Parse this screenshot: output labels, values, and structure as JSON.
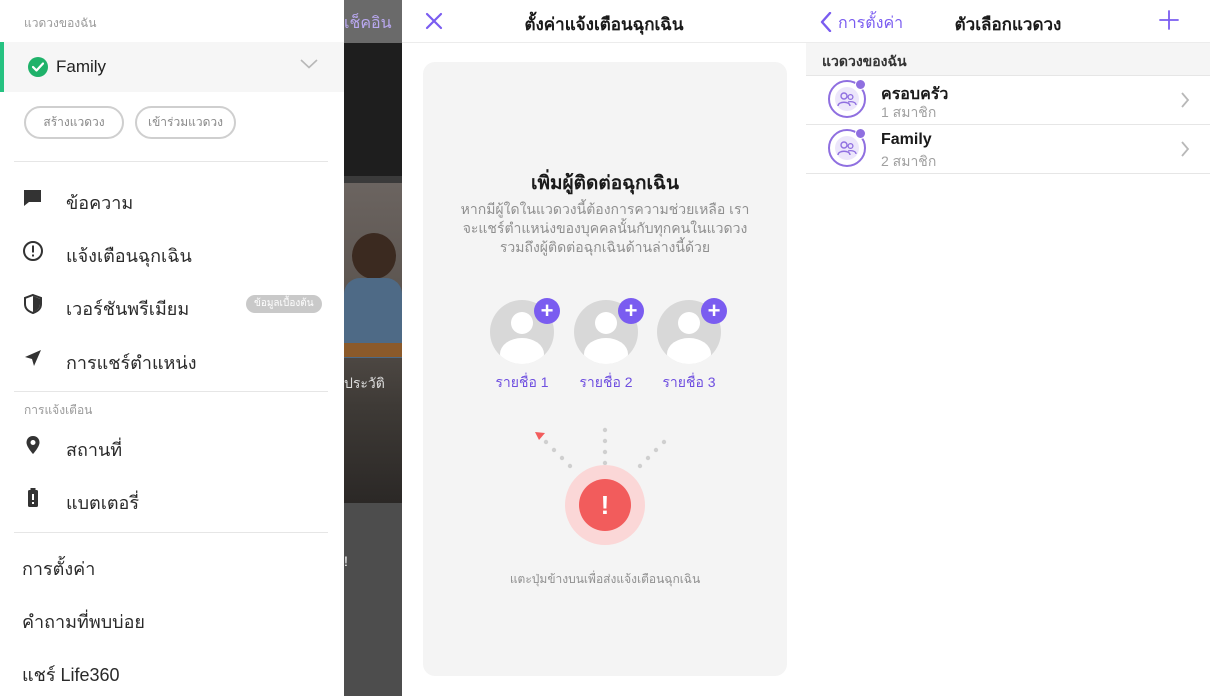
{
  "panel1": {
    "bg_tab_label": "เช็คอิน",
    "bg_caption": "ประวัติ",
    "bg_text_lower": "!",
    "my_circles_label": "แวดวงของฉัน",
    "current_circle": "Family",
    "create_circle_label": "สร้างแวดวง",
    "join_circle_label": "เข้าร่วมแวดวง",
    "menu": [
      {
        "icon": "message-icon",
        "label": "ข้อความ"
      },
      {
        "icon": "alert-circle-icon",
        "label": "แจ้งเตือนฉุกเฉิน"
      },
      {
        "icon": "shield-icon",
        "label": "เวอร์ชันพรีเมียม",
        "badge": "ข้อมูลเบื้องต้น"
      },
      {
        "icon": "location-arrow-icon",
        "label": "การแชร์ตำแหน่ง"
      }
    ],
    "notifications_label": "การแจ้งเตือน",
    "notif_menu": [
      {
        "icon": "map-pin-icon",
        "label": "สถานที่"
      },
      {
        "icon": "battery-icon",
        "label": "แบตเตอรี่"
      }
    ],
    "bottom_menu": [
      "การตั้งค่า",
      "คำถามที่พบบ่อย",
      "แชร์ Life360"
    ]
  },
  "panel2": {
    "title": "ตั้งค่าแจ้งเตือนฉุกเฉิน",
    "heading": "เพิ่มผู้ติดต่อฉุกเฉิน",
    "description": "หากมีผู้ใดในแวดวงนี้ต้องการความช่วยเหลือ เราจะแชร์ตำแหน่งของบุคคลนั้นกับทุกคนในแวดวง รวมถึงผู้ติดต่อฉุกเฉินด้านล่างนี้ด้วย",
    "contacts": [
      "รายชื่อ 1",
      "รายชื่อ 2",
      "รายชื่อ 3"
    ],
    "sos_symbol": "!",
    "hint": "แตะปุ่มข้างบนเพื่อส่งแจ้งเตือนฉุกเฉิน"
  },
  "panel3": {
    "back_label": "การตั้งค่า",
    "title": "ตัวเลือกแวดวง",
    "section_label": "แวดวงของฉัน",
    "circles": [
      {
        "name": "ครอบครัว",
        "members": "1 สมาชิก"
      },
      {
        "name": "Family",
        "members": "2 สมาชิก"
      }
    ]
  },
  "colors": {
    "accent": "#7a5cf0",
    "success": "#1fb26a",
    "danger": "#f25c5c"
  }
}
